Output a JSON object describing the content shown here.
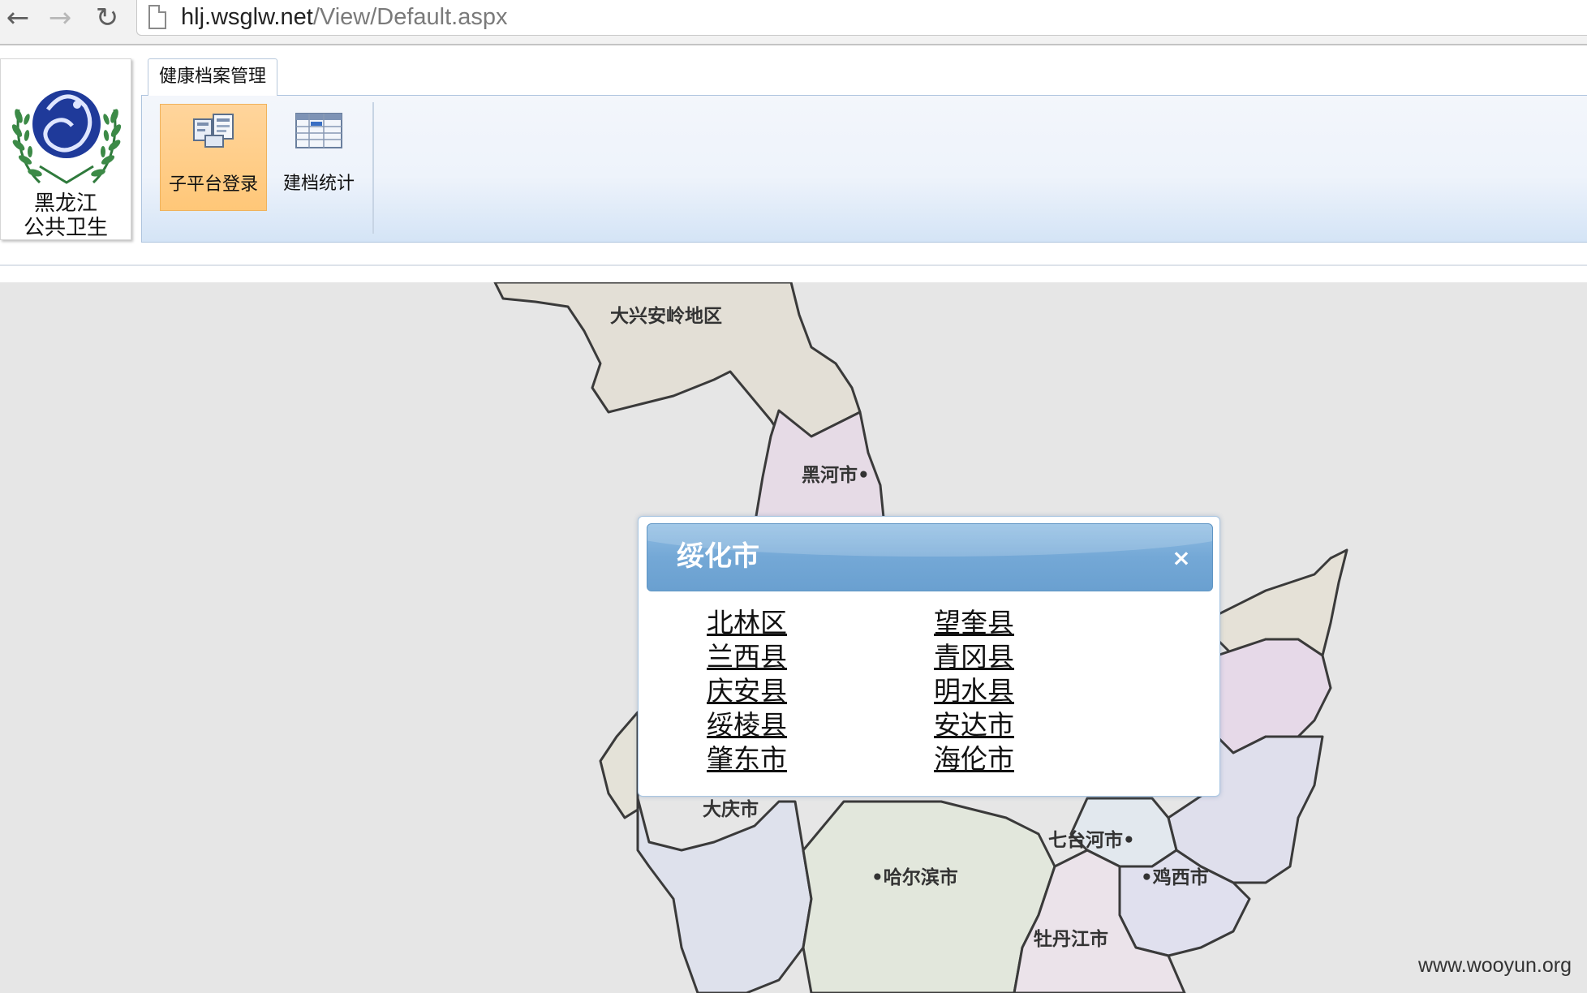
{
  "browser": {
    "url_host": "hlj.wsglw.net",
    "url_path": "/View/Default.aspx"
  },
  "app": {
    "logo": {
      "line1": "黑龙江",
      "line2": "公共卫生"
    },
    "tab_active": "健康档案管理",
    "ribbon_buttons": [
      {
        "label": "子平台登录",
        "icon": "subplatform-login-icon",
        "selected": true
      },
      {
        "label": "建档统计",
        "icon": "table-stats-icon",
        "selected": false
      }
    ]
  },
  "map": {
    "labels": [
      {
        "text": "大兴安岭地区"
      },
      {
        "text": "黑河市•"
      },
      {
        "text": "大庆市"
      },
      {
        "text": "•哈尔滨市"
      },
      {
        "text": "七台河市•"
      },
      {
        "text": "•鸡西市"
      },
      {
        "text": "牡丹江市"
      }
    ]
  },
  "modal": {
    "title": "绥化市",
    "close_symbol": "×",
    "left_column": [
      "北林区",
      "兰西县",
      "庆安县",
      "绥棱县",
      "肇东市"
    ],
    "right_column": [
      "望奎县",
      "青冈县",
      "明水县",
      "安达市",
      "海伦市"
    ]
  },
  "watermark": "www.wooyun.org",
  "colors": {
    "modal_header": "#74a8d6",
    "ribbon_selected": "#ffc778",
    "map_background": "#e6e6e6"
  }
}
